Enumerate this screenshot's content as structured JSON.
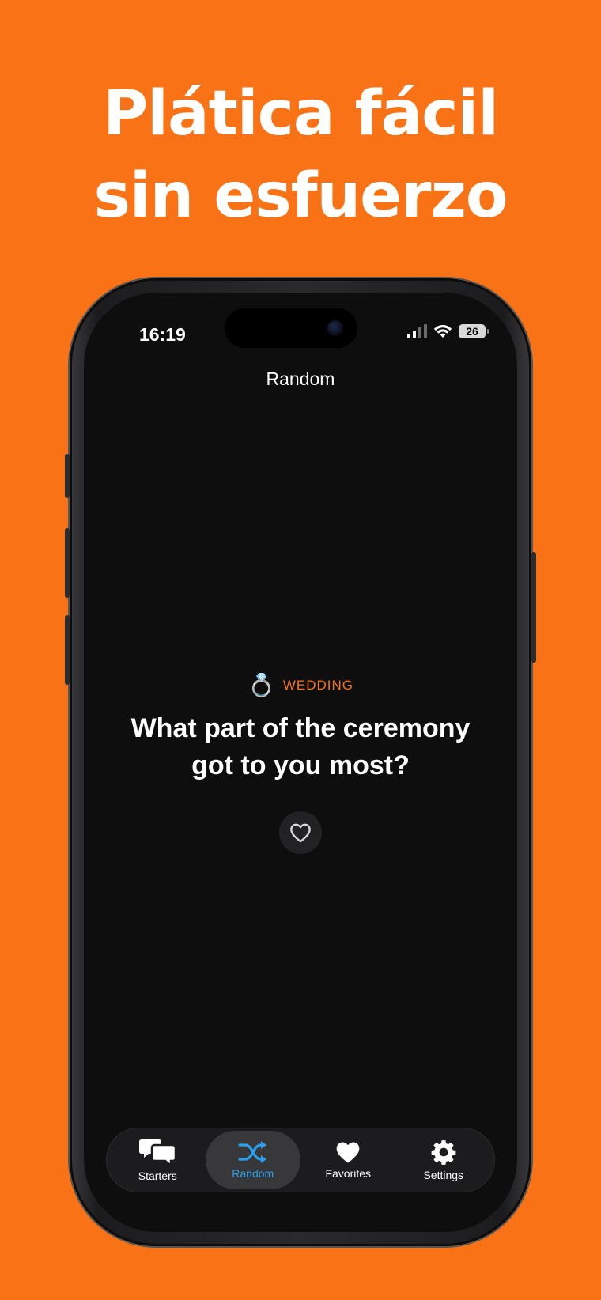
{
  "headline": {
    "line1": "Plática fácil",
    "line2": "sin esfuerzo"
  },
  "status_bar": {
    "time": "16:19",
    "battery": "26"
  },
  "screen": {
    "title": "Random",
    "category": {
      "emoji": "💍",
      "label": "WEDDING",
      "color": "#F97316"
    },
    "question": "What part of the ceremony got to you most?",
    "favorite_icon": "heart-outline-icon"
  },
  "tab_bar": {
    "active_tab": "Random",
    "accent": "#2aa1f0",
    "tabs": [
      {
        "label": "Starters",
        "icon": "chat-bubbles-icon"
      },
      {
        "label": "Random",
        "icon": "shuffle-icon"
      },
      {
        "label": "Favorites",
        "icon": "heart-icon"
      },
      {
        "label": "Settings",
        "icon": "gear-icon"
      }
    ]
  },
  "colors": {
    "background": "#F97316",
    "screen_bg": "#0e0e0e"
  }
}
